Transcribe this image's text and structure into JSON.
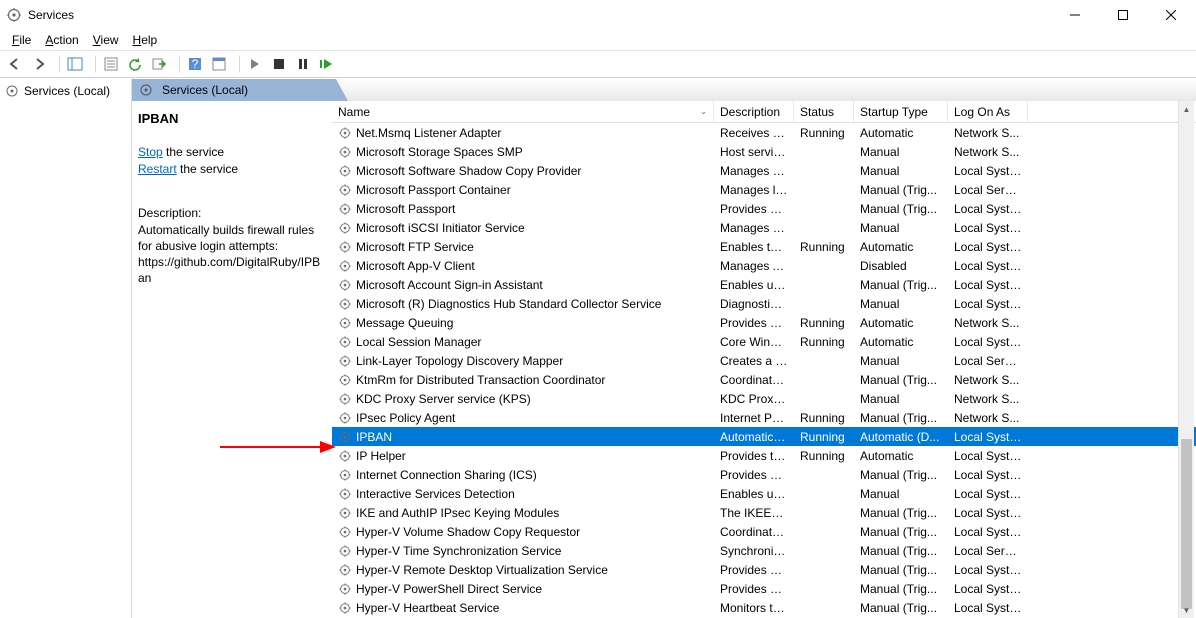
{
  "window": {
    "title": "Services",
    "min_tip": "Minimize",
    "max_tip": "Maximize",
    "close_tip": "Close"
  },
  "menubar": {
    "file": "File",
    "action": "Action",
    "view": "View",
    "help": "Help"
  },
  "toolbar": {
    "back": "Back",
    "forward": "Forward",
    "show_panel": "Show/Hide Console Tree",
    "export": "Export List",
    "refresh": "Refresh",
    "stop_refresh": "Stop Refresh",
    "help": "Help",
    "properties": "Properties",
    "start": "Start",
    "stop": "Stop",
    "pause": "Pause",
    "restart": "Restart"
  },
  "tree": {
    "root": "Services (Local)"
  },
  "rightpane_header": "Services (Local)",
  "detail": {
    "selected_name": "IPBAN",
    "stop_label": "Stop",
    "stop_suffix": " the service",
    "restart_label": "Restart",
    "restart_suffix": " the service",
    "description_label": "Description:",
    "description_text": "Automatically builds firewall rules for abusive login attempts: https://github.com/DigitalRuby/IPBan"
  },
  "columns": {
    "name": "Name",
    "description": "Description",
    "status": "Status",
    "startup": "Startup Type",
    "logon": "Log On As"
  },
  "services": [
    {
      "name": "Net.Msmq Listener Adapter",
      "desc": "Receives act...",
      "status": "Running",
      "startup": "Automatic",
      "logon": "Network S...",
      "selected": false
    },
    {
      "name": "Microsoft Storage Spaces SMP",
      "desc": "Host service...",
      "status": "",
      "startup": "Manual",
      "logon": "Network S...",
      "selected": false
    },
    {
      "name": "Microsoft Software Shadow Copy Provider",
      "desc": "Manages so...",
      "status": "",
      "startup": "Manual",
      "logon": "Local Syste...",
      "selected": false
    },
    {
      "name": "Microsoft Passport Container",
      "desc": "Manages lo...",
      "status": "",
      "startup": "Manual (Trig...",
      "logon": "Local Service",
      "selected": false
    },
    {
      "name": "Microsoft Passport",
      "desc": "Provides pr...",
      "status": "",
      "startup": "Manual (Trig...",
      "logon": "Local Syste...",
      "selected": false
    },
    {
      "name": "Microsoft iSCSI Initiator Service",
      "desc": "Manages In...",
      "status": "",
      "startup": "Manual",
      "logon": "Local Syste...",
      "selected": false
    },
    {
      "name": "Microsoft FTP Service",
      "desc": "Enables this...",
      "status": "Running",
      "startup": "Automatic",
      "logon": "Local Syste...",
      "selected": false
    },
    {
      "name": "Microsoft App-V Client",
      "desc": "Manages A...",
      "status": "",
      "startup": "Disabled",
      "logon": "Local Syste...",
      "selected": false
    },
    {
      "name": "Microsoft Account Sign-in Assistant",
      "desc": "Enables use...",
      "status": "",
      "startup": "Manual (Trig...",
      "logon": "Local Syste...",
      "selected": false
    },
    {
      "name": "Microsoft (R) Diagnostics Hub Standard Collector Service",
      "desc": "Diagnostics ...",
      "status": "",
      "startup": "Manual",
      "logon": "Local Syste...",
      "selected": false
    },
    {
      "name": "Message Queuing",
      "desc": "Provides a ...",
      "status": "Running",
      "startup": "Automatic",
      "logon": "Network S...",
      "selected": false
    },
    {
      "name": "Local Session Manager",
      "desc": "Core Windo...",
      "status": "Running",
      "startup": "Automatic",
      "logon": "Local Syste...",
      "selected": false
    },
    {
      "name": "Link-Layer Topology Discovery Mapper",
      "desc": "Creates a N...",
      "status": "",
      "startup": "Manual",
      "logon": "Local Service",
      "selected": false
    },
    {
      "name": "KtmRm for Distributed Transaction Coordinator",
      "desc": "Coordinates...",
      "status": "",
      "startup": "Manual (Trig...",
      "logon": "Network S...",
      "selected": false
    },
    {
      "name": "KDC Proxy Server service (KPS)",
      "desc": "KDC Proxy S...",
      "status": "",
      "startup": "Manual",
      "logon": "Network S...",
      "selected": false
    },
    {
      "name": "IPsec Policy Agent",
      "desc": "Internet Pro...",
      "status": "Running",
      "startup": "Manual (Trig...",
      "logon": "Network S...",
      "selected": false
    },
    {
      "name": "IPBAN",
      "desc": "Automatica...",
      "status": "Running",
      "startup": "Automatic (D...",
      "logon": "Local Syste...",
      "selected": true
    },
    {
      "name": "IP Helper",
      "desc": "Provides tu...",
      "status": "Running",
      "startup": "Automatic",
      "logon": "Local Syste...",
      "selected": false
    },
    {
      "name": "Internet Connection Sharing (ICS)",
      "desc": "Provides ne...",
      "status": "",
      "startup": "Manual (Trig...",
      "logon": "Local Syste...",
      "selected": false
    },
    {
      "name": "Interactive Services Detection",
      "desc": "Enables use...",
      "status": "",
      "startup": "Manual",
      "logon": "Local Syste...",
      "selected": false
    },
    {
      "name": "IKE and AuthIP IPsec Keying Modules",
      "desc": "The IKEEXT ...",
      "status": "",
      "startup": "Manual (Trig...",
      "logon": "Local Syste...",
      "selected": false
    },
    {
      "name": "Hyper-V Volume Shadow Copy Requestor",
      "desc": "Coordinates...",
      "status": "",
      "startup": "Manual (Trig...",
      "logon": "Local Syste...",
      "selected": false
    },
    {
      "name": "Hyper-V Time Synchronization Service",
      "desc": "Synchronize...",
      "status": "",
      "startup": "Manual (Trig...",
      "logon": "Local Service",
      "selected": false
    },
    {
      "name": "Hyper-V Remote Desktop Virtualization Service",
      "desc": "Provides a p...",
      "status": "",
      "startup": "Manual (Trig...",
      "logon": "Local Syste...",
      "selected": false
    },
    {
      "name": "Hyper-V PowerShell Direct Service",
      "desc": "Provides a ...",
      "status": "",
      "startup": "Manual (Trig...",
      "logon": "Local Syste...",
      "selected": false
    },
    {
      "name": "Hyper-V Heartbeat Service",
      "desc": "Monitors th...",
      "status": "",
      "startup": "Manual (Trig...",
      "logon": "Local Syste...",
      "selected": false
    }
  ]
}
